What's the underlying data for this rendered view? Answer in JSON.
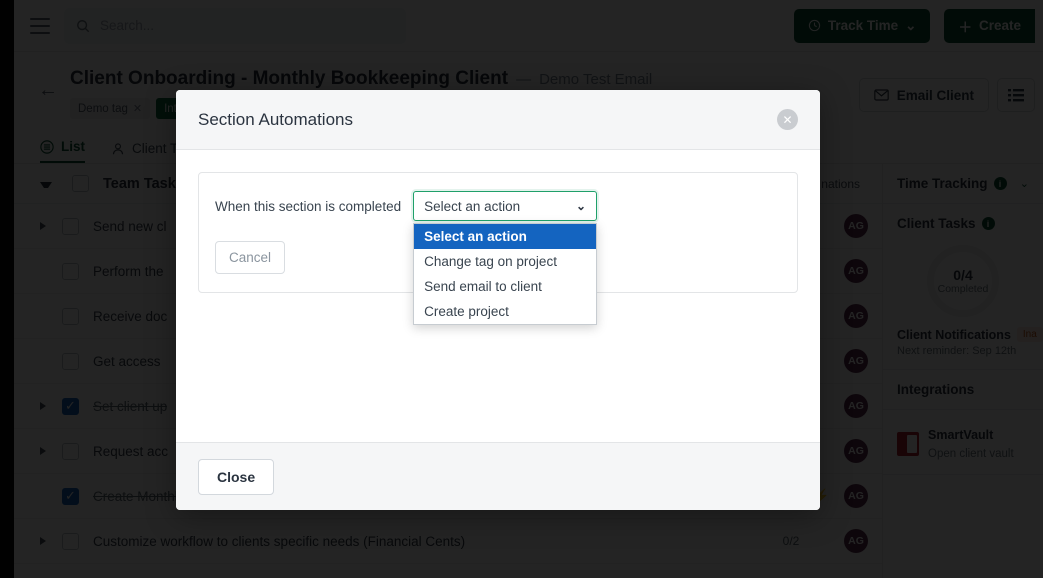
{
  "topbar": {
    "menu_icon": "hamburger-icon",
    "search_placeholder": "Search...",
    "search_value": "",
    "search_icon": "search-icon",
    "track_time_label": "Track Time",
    "track_time_icon": "clock-icon",
    "track_time_chevron": "⌄",
    "create_label": "Create",
    "create_icon": "plus-icon"
  },
  "page_header": {
    "back_icon": "back-arrow-icon",
    "title": "Client Onboarding - Monthly Bookkeeping Client",
    "dash": "—",
    "subtitle": "Demo Test Email",
    "tags": [
      {
        "label": "Demo tag",
        "removable": "✕",
        "color": "#eceef0"
      },
      {
        "label": "Intro M",
        "removable": "",
        "color": "#0f6b3f"
      }
    ],
    "email_client_label": "Email Client",
    "email_client_icon": "envelope-icon",
    "list-view_icon": "list-icon"
  },
  "tabs": [
    {
      "label": "List",
      "icon": "list-circle-icon",
      "active": true
    },
    {
      "label": "Client T",
      "icon": "person-icon",
      "active": false
    }
  ],
  "task_list": {
    "section_name": "Team Tasks",
    "automations_header": "nations",
    "rows": [
      {
        "name": "Send new cl",
        "checked": false,
        "caret": true,
        "bolt": false,
        "avatar": "AG"
      },
      {
        "name": "Perform the",
        "checked": false,
        "caret": false,
        "bolt": false,
        "avatar": "AG"
      },
      {
        "name": "Receive doc",
        "checked": false,
        "caret": false,
        "bolt": false,
        "avatar": "AG"
      },
      {
        "name": "Get access",
        "checked": false,
        "caret": false,
        "bolt": false,
        "avatar": "AG"
      },
      {
        "name": "Set client up",
        "checked": true,
        "caret": true,
        "bolt": false,
        "avatar": "AG"
      },
      {
        "name": "Request acc",
        "checked": false,
        "caret": true,
        "bolt": false,
        "avatar": "AG"
      },
      {
        "name": "Create Monthly Bookkeeping Project",
        "checked": true,
        "caret": false,
        "bolt": true,
        "avatar": "AG"
      },
      {
        "name": "Customize workflow to clients specific needs (Financial Cents)",
        "checked": false,
        "caret": true,
        "bolt": false,
        "progress": "0/2",
        "avatar": "AG"
      }
    ]
  },
  "right_sidebar": {
    "time_tracking": {
      "title": "Time Tracking",
      "info": "i",
      "chevron": "⌄"
    },
    "client_tasks": {
      "title": "Client Tasks",
      "info": "i"
    },
    "donut": {
      "value": "0/4",
      "label": "Completed"
    },
    "notifications": {
      "title": "Client Notifications",
      "badge": "Ina",
      "note": "Next reminder: Sep 12th"
    },
    "integrations": {
      "title": "Integrations",
      "items": [
        {
          "name": "SmartVault",
          "sub": "Open client vault",
          "icon": "smartvault-icon"
        }
      ]
    }
  },
  "modal": {
    "title": "Section Automations",
    "close_icon": "close-icon",
    "condition_label": "When this section is completed",
    "select": {
      "value": "Select an action",
      "chevron_icon": "chevron-down-icon",
      "options": [
        "Select an action",
        "Change tag on project",
        "Send email to client",
        "Create project"
      ],
      "selected_index": 0,
      "border_color": "#1fa06a",
      "highlight_color": "#1464c0"
    },
    "cancel_label": "Cancel",
    "close_label": "Close"
  }
}
